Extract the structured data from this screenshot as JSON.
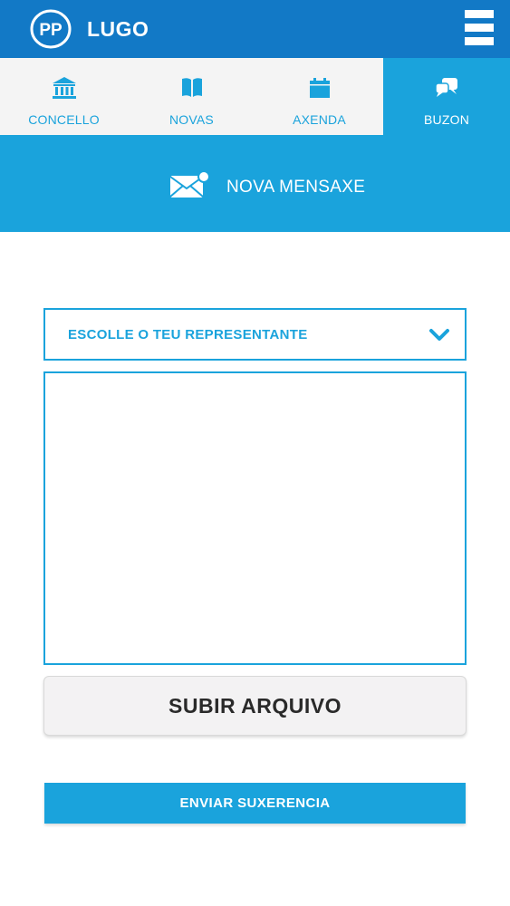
{
  "header": {
    "logo_text": "PP",
    "title": "LUGO",
    "menu_icon": "hamburger-menu-icon"
  },
  "tabs": [
    {
      "label": "CONCELLO",
      "icon": "town-hall-icon",
      "active": false
    },
    {
      "label": "NOVAS",
      "icon": "book-icon",
      "active": false
    },
    {
      "label": "AXENDA",
      "icon": "calendar-icon",
      "active": false
    },
    {
      "label": "BUZON",
      "icon": "chat-bubbles-icon",
      "active": true
    }
  ],
  "banner": {
    "icon": "mail-notification-icon",
    "text": "NOVA MENSAXE"
  },
  "form": {
    "select_placeholder": "ESCOLLE O TEU REPRESENTANTE",
    "message_value": "",
    "upload_label": "SUBIR ARQUIVO",
    "submit_label": "ENVIAR SUXERENCIA"
  },
  "colors": {
    "header_blue": "#1279c6",
    "accent_blue": "#1aa3dc",
    "tab_background": "#f4f4f4",
    "white": "#ffffff"
  }
}
